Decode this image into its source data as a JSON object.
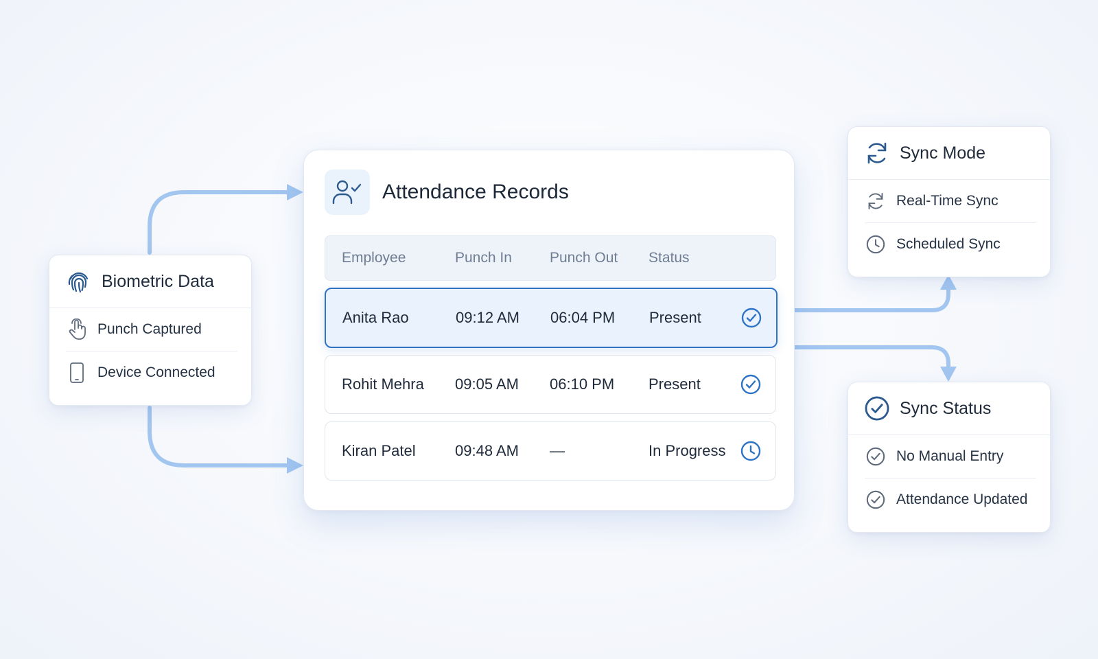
{
  "biometric": {
    "title": "Biometric Data",
    "icon": "fingerprint-icon",
    "items": [
      {
        "label": "Punch Captured",
        "icon": "touch-hand-icon"
      },
      {
        "label": "Device Connected",
        "icon": "smartphone-icon"
      }
    ]
  },
  "attendance": {
    "title": "Attendance Records",
    "icon": "user-check-icon",
    "columns": [
      "Employee",
      "Punch In",
      "Punch Out",
      "Status"
    ],
    "rows": [
      {
        "employee": "Anita Rao",
        "punch_in": "09:12 AM",
        "punch_out": "06:04 PM",
        "status": "Present",
        "status_icon": "check-circle-icon",
        "selected": true
      },
      {
        "employee": "Rohit Mehra",
        "punch_in": "09:05 AM",
        "punch_out": "06:10 PM",
        "status": "Present",
        "status_icon": "check-circle-icon",
        "selected": false
      },
      {
        "employee": "Kiran Patel",
        "punch_in": "09:48 AM",
        "punch_out": "—",
        "status": "In Progress",
        "status_icon": "clock-icon",
        "selected": false
      }
    ]
  },
  "sync_mode": {
    "title": "Sync Mode",
    "icon": "sync-icon",
    "items": [
      {
        "label": "Real-Time Sync",
        "icon": "refresh-icon"
      },
      {
        "label": "Scheduled Sync",
        "icon": "clock-icon"
      }
    ]
  },
  "sync_status": {
    "title": "Sync Status",
    "icon": "check-circle-icon",
    "items": [
      {
        "label": "No Manual Entry",
        "icon": "check-circle-icon"
      },
      {
        "label": "Attendance Updated",
        "icon": "check-circle-icon"
      }
    ]
  },
  "colors": {
    "accent": "#2e73c5",
    "icon_dark": "#2c5a8e",
    "icon_gray": "#5f6b7c",
    "connector": "#9fc4f0",
    "selected_row_bg": "#eaf3fd"
  }
}
